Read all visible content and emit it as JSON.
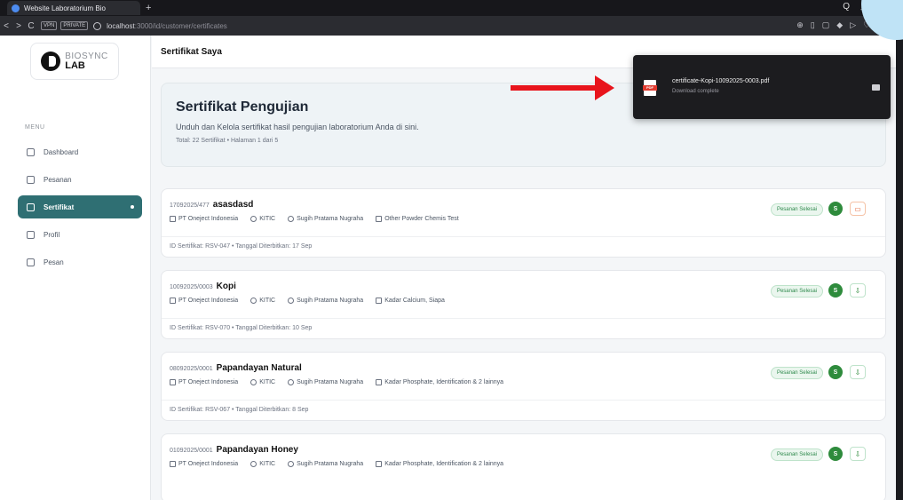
{
  "browser": {
    "tab_title": "Website Laboratorium Bio",
    "new_tab": "+",
    "search_glyph": "Q",
    "minimize_glyph": "_",
    "url_host": "localhost",
    "url_path": ":3000/id/customer/certificates",
    "badges": {
      "vpn": "VPN",
      "private": "PRIVATE"
    },
    "nav": {
      "back": "<",
      "forward": ">",
      "reload": "C"
    }
  },
  "sidebar": {
    "logo_top": "BIOSYNC",
    "logo_bottom": "LAB",
    "menu_label": "MENU",
    "items": [
      {
        "label": "Dashboard",
        "icon": "grid-icon"
      },
      {
        "label": "Pesanan",
        "icon": "calendar-icon"
      },
      {
        "label": "Sertifikat",
        "icon": "document-icon",
        "active": true
      },
      {
        "label": "Profil",
        "icon": "user-icon"
      },
      {
        "label": "Pesan",
        "icon": "chat-icon"
      }
    ]
  },
  "header": {
    "title": "Sertifikat Saya"
  },
  "hero": {
    "title": "Sertifikat Pengujian",
    "description": "Unduh dan Kelola sertifikat hasil pengujian laboratorium Anda di sini.",
    "meta": "Total: 22 Sertifikat  •  Halaman 1 dari 5"
  },
  "certificates": [
    {
      "code": "17092025/477",
      "name": "asasdasd",
      "company": "PT Oneject Indonesia",
      "location": "KITIC",
      "person": "Sugih Pratama Nugraha",
      "test": "Other Powder Chemis Test",
      "footer": "ID Sertifikat: RSV-047  •  Tanggal Diterbitkan: 17 Sep",
      "status": "Pesanan Selesai",
      "avatar": "S",
      "action": "chat"
    },
    {
      "code": "10092025/0003",
      "name": "Kopi",
      "company": "PT Oneject Indonesia",
      "location": "KITIC",
      "person": "Sugih Pratama Nugraha",
      "test": "Kadar Calcium, Siapa",
      "footer": "ID Sertifikat: RSV-070  •  Tanggal Diterbitkan: 10 Sep",
      "status": "Pesanan Selesai",
      "avatar": "S",
      "action": "download"
    },
    {
      "code": "08092025/0001",
      "name": "Papandayan Natural",
      "company": "PT Oneject Indonesia",
      "location": "KITIC",
      "person": "Sugih Pratama Nugraha",
      "test": "Kadar Phosphate, Identification & 2 lainnya",
      "footer": "ID Sertifikat: RSV-067  •  Tanggal Diterbitkan: 8 Sep",
      "status": "Pesanan Selesai",
      "avatar": "S",
      "action": "download"
    },
    {
      "code": "01092025/0001",
      "name": "Papandayan Honey",
      "company": "PT Oneject Indonesia",
      "location": "KITIC",
      "person": "Sugih Pratama Nugraha",
      "test": "Kadar Phosphate, Identification & 2 lainnya",
      "footer": "",
      "status": "Pesanan Selesai",
      "avatar": "S",
      "action": "download"
    }
  ],
  "download": {
    "filename": "certificate-Kopi-10092025-0003.pdf",
    "status": "Download complete"
  },
  "colors": {
    "accent": "#2f6f73",
    "status_green": "#2e8b3c",
    "arrow": "#e8141c"
  }
}
